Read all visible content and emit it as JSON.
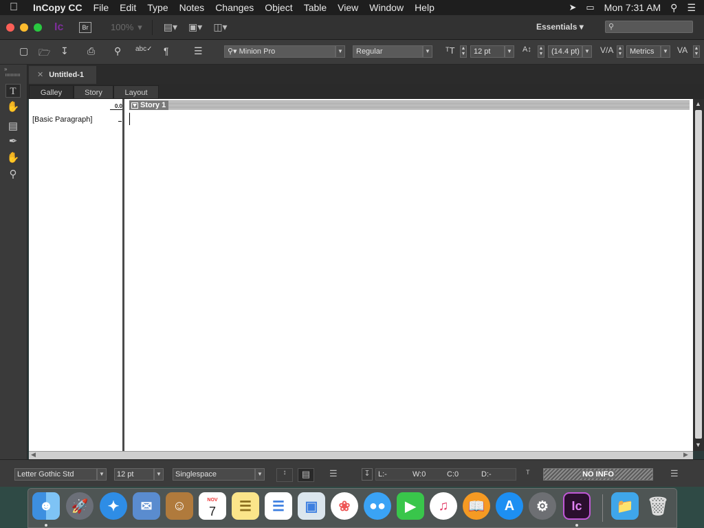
{
  "menubar": {
    "apple_icon": "apple-icon",
    "app_name": "InCopy CC",
    "items": [
      "File",
      "Edit",
      "Type",
      "Notes",
      "Changes",
      "Object",
      "Table",
      "View",
      "Window",
      "Help"
    ],
    "clock": "Mon 7:31 AM"
  },
  "titlebar": {
    "app_logo": "Ic",
    "bridge_label": "Br",
    "zoom": "100%",
    "workspace": "Essentials",
    "search_placeholder": ""
  },
  "controlbar": {
    "font_family": "Minion Pro",
    "font_style": "Regular",
    "font_size": "12 pt",
    "leading": "(14.4 pt)",
    "kerning": "Metrics"
  },
  "document": {
    "tab_title": "Untitled-1",
    "view_tabs": [
      "Galley",
      "Story",
      "Layout"
    ],
    "depth_label": "0.0",
    "paragraph_style": "[Basic Paragraph]",
    "story_name": "Story 1"
  },
  "statusbar": {
    "font": "Letter Gothic Std",
    "size": "12 pt",
    "spacing": "Singlespace",
    "lines": "L:-",
    "words": "W:0",
    "chars": "C:0",
    "depth": "D:-",
    "info": "NO INFO"
  },
  "dock": {
    "apps": [
      "Finder",
      "Launchpad",
      "Safari",
      "Mail",
      "Contacts",
      "Calendar",
      "Notes",
      "Reminders",
      "Preview",
      "Photos",
      "Messages",
      "FaceTime",
      "iTunes",
      "iBooks",
      "App Store",
      "System Preferences",
      "InCopy CC"
    ],
    "calendar_month": "NOV",
    "calendar_day": "7",
    "incopy_label": "Ic"
  },
  "colors": {
    "incopy_brand": "#7d2e9a",
    "panel_bg": "#3b3b3b",
    "menubar_bg": "#1e1e1e"
  }
}
